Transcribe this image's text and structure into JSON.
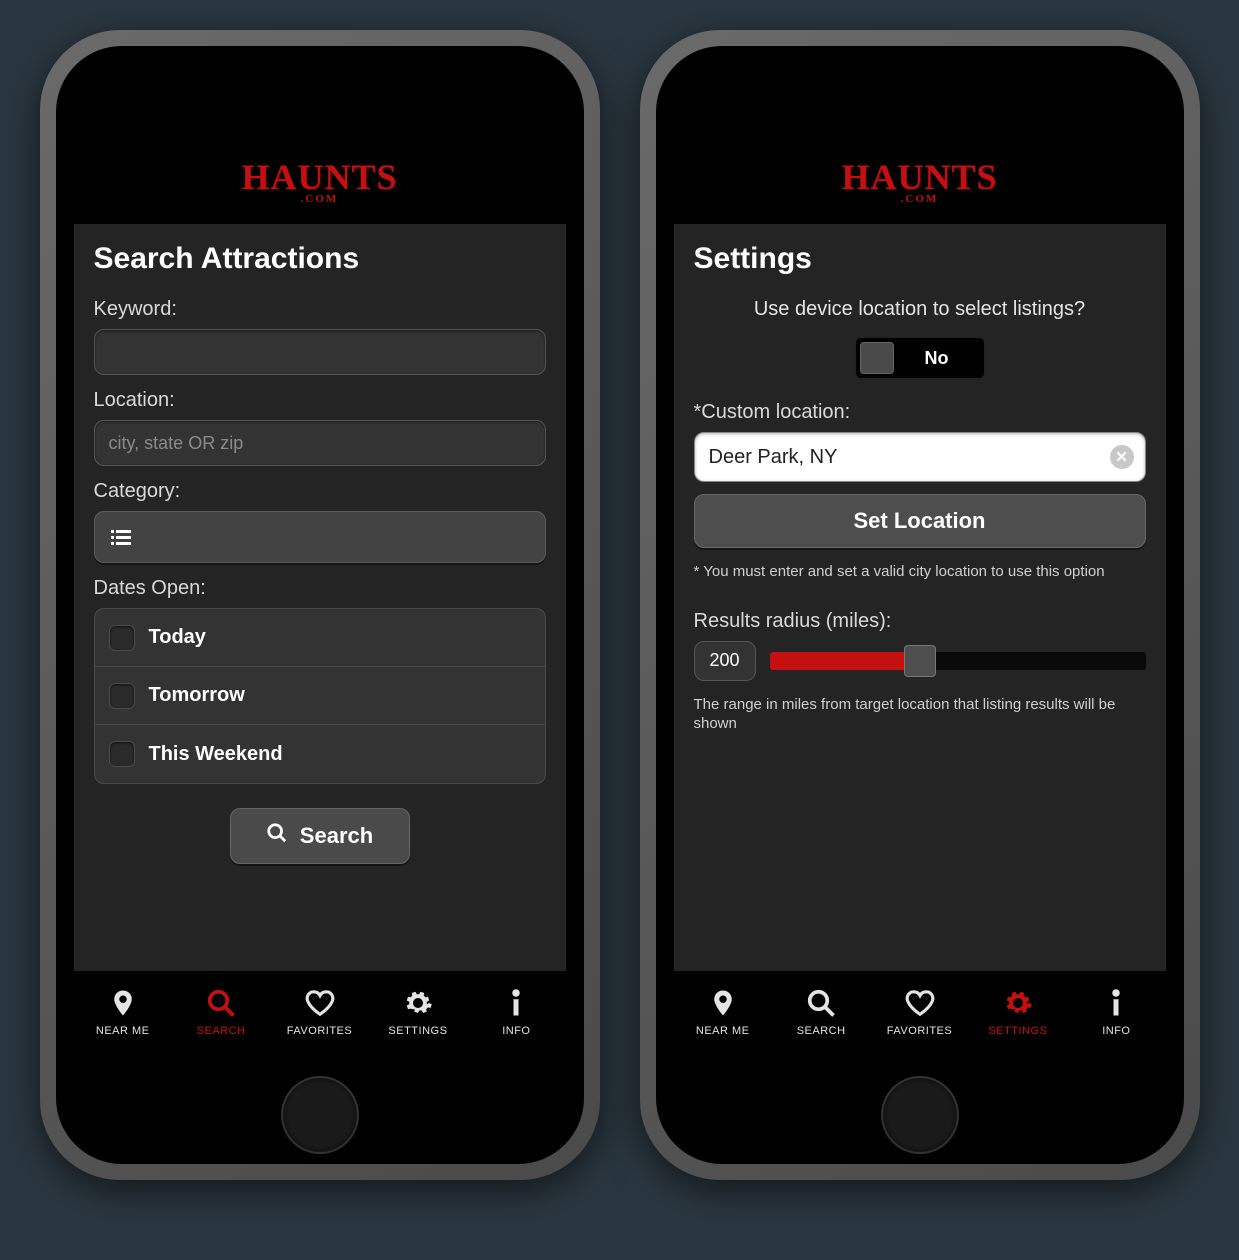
{
  "brand": {
    "name": "HAUNTS",
    "suffix": ".COM",
    "accent": "#c41010"
  },
  "tabs": {
    "nearme": "NEAR ME",
    "search": "SEARCH",
    "favorites": "FAVORITES",
    "settings": "SETTINGS",
    "info": "INFO"
  },
  "left": {
    "title": "Search Attractions",
    "keyword_label": "Keyword:",
    "keyword_value": "",
    "location_label": "Location:",
    "location_placeholder": "city, state OR zip",
    "location_value": "",
    "category_label": "Category:",
    "dates_label": "Dates Open:",
    "dates": [
      "Today",
      "Tomorrow",
      "This Weekend"
    ],
    "search_button": "Search",
    "active_tab": "SEARCH"
  },
  "right": {
    "title": "Settings",
    "device_question": "Use device location to select listings?",
    "toggle_value": "No",
    "custom_location_label": "*Custom location:",
    "custom_location_value": "Deer Park, NY",
    "set_location_button": "Set Location",
    "location_helper": "* You must enter and set a valid city location to use this option",
    "radius_label": "Results radius (miles):",
    "radius_value": "200",
    "radius_fill_percent": 40,
    "radius_helper": "The range in miles from target location that listing results will be shown",
    "active_tab": "SETTINGS"
  }
}
